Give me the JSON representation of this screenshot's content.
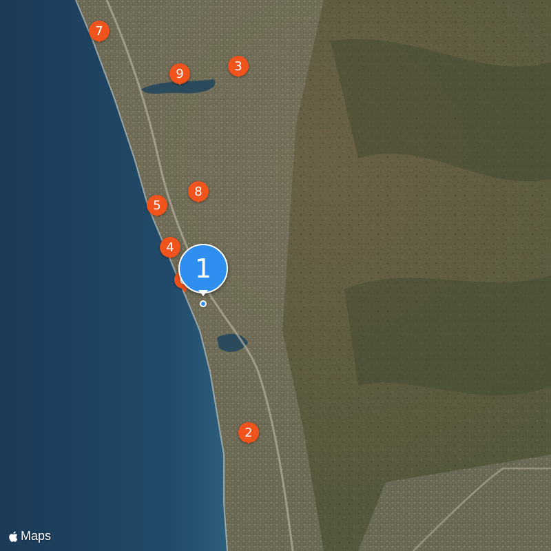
{
  "map": {
    "view": "satellite",
    "colors": {
      "ocean_deep": "#1d3d5a",
      "ocean_shallow": "#2f5f7c",
      "land": "#5a5a3f",
      "pin": "#f0531c",
      "selected_pin": "#2f8ff0"
    }
  },
  "pins": [
    {
      "label": "1",
      "selected": true
    },
    {
      "label": "2"
    },
    {
      "label": "3"
    },
    {
      "label": "4"
    },
    {
      "label": "5"
    },
    {
      "label": "6"
    },
    {
      "label": "7"
    },
    {
      "label": "8"
    },
    {
      "label": "9"
    }
  ],
  "attribution": {
    "icon": "apple-logo-icon",
    "label": "Maps"
  }
}
